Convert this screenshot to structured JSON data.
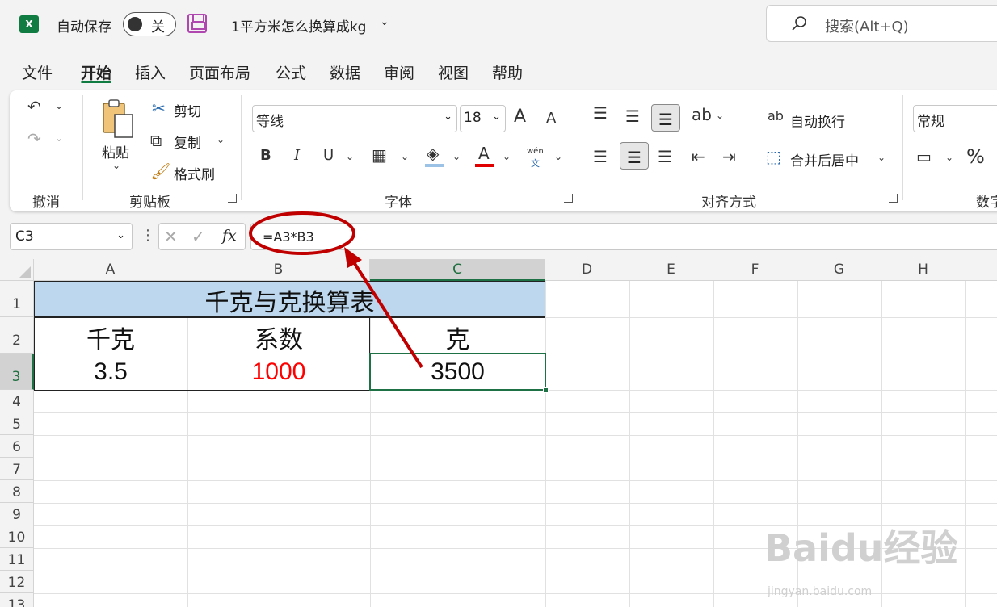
{
  "titlebar": {
    "autosave_label": "自动保存",
    "autosave_state": "关",
    "doc_title": "1平方米怎么换算成kg",
    "search_placeholder": "搜索(Alt+Q)"
  },
  "menu": [
    "文件",
    "开始",
    "插入",
    "页面布局",
    "公式",
    "数据",
    "审阅",
    "视图",
    "帮助"
  ],
  "ribbon": {
    "undo_group": "撤消",
    "clipboard": {
      "paste": "粘贴",
      "cut": "剪切",
      "copy": "复制",
      "format_painter": "格式刷",
      "group": "剪贴板"
    },
    "font": {
      "name": "等线",
      "size": "18",
      "bold": "B",
      "italic": "I",
      "underline": "U",
      "group": "字体",
      "grow": "A",
      "shrink": "A",
      "phonetic_top": "wén",
      "phonetic_bottom": "文"
    },
    "alignment": {
      "wrap": "自动换行",
      "merge": "合并后居中",
      "group": "对齐方式"
    },
    "number": {
      "format": "常规",
      "group": "数字",
      "percent": "%"
    }
  },
  "formula_bar": {
    "namebox": "C3",
    "formula": "=A3*B3",
    "fx": "fx"
  },
  "sheet": {
    "columns": [
      "A",
      "B",
      "C",
      "D",
      "E",
      "F",
      "G",
      "H"
    ],
    "rows": [
      "1",
      "2",
      "3",
      "4",
      "5",
      "6",
      "7",
      "8",
      "9",
      "10",
      "11",
      "12",
      "13"
    ],
    "title": "千克与克换算表",
    "headers": [
      "千克",
      "系数",
      "克"
    ],
    "row3": [
      "3.5",
      "1000",
      "3500"
    ]
  },
  "watermark": {
    "brand": "Baidu经验",
    "url": "jingyan.baidu.com"
  },
  "colors": {
    "accent": "#107c41",
    "header_fill": "#bdd7ee",
    "red_value": "#ff0000",
    "annotation": "#c00000"
  }
}
